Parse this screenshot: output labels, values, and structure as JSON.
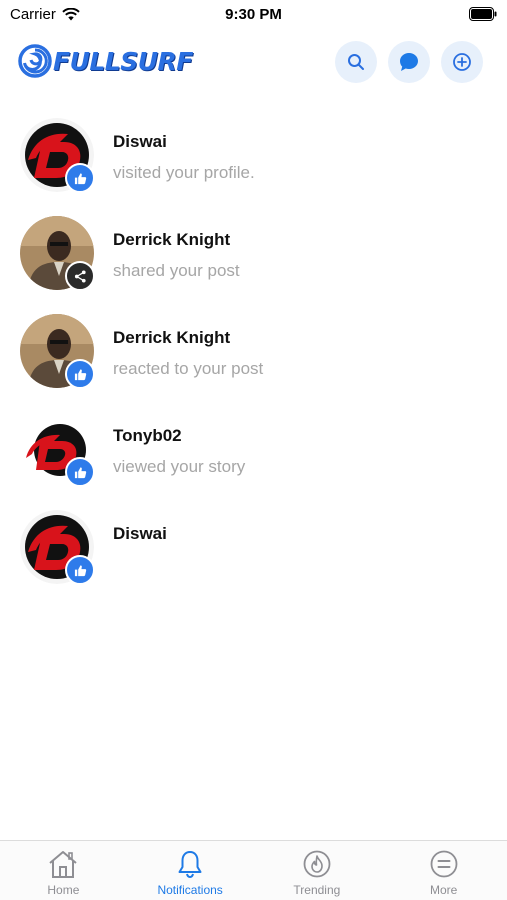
{
  "status_bar": {
    "carrier": "Carrier",
    "time": "9:30 PM"
  },
  "header": {
    "logo_text": "FULLSURF",
    "brand_color": "#2a6fe0",
    "buttons": {
      "search": "search-icon",
      "chat": "chat-bubble-icon",
      "add": "plus-circle-icon"
    }
  },
  "notifications": [
    {
      "name": "Diswai",
      "text": "visited your profile.",
      "avatar": "d-logo-large",
      "badge": "like"
    },
    {
      "name": "Derrick Knight",
      "text": "shared your post",
      "avatar": "photo-man",
      "badge": "share"
    },
    {
      "name": "Derrick Knight",
      "text": "reacted to your post",
      "avatar": "photo-man",
      "badge": "like"
    },
    {
      "name": "Tonyb02",
      "text": "viewed your story",
      "avatar": "d-logo-small",
      "badge": "like"
    },
    {
      "name": "Diswai",
      "text": "",
      "avatar": "d-logo-large",
      "badge": "like"
    }
  ],
  "tab_bar": {
    "active_color": "#1e7ae6",
    "items": [
      {
        "label": "Home",
        "icon": "home-icon"
      },
      {
        "label": "Notifications",
        "icon": "bell-icon",
        "active": true
      },
      {
        "label": "Trending",
        "icon": "flame-icon"
      },
      {
        "label": "More",
        "icon": "menu-icon"
      }
    ]
  }
}
